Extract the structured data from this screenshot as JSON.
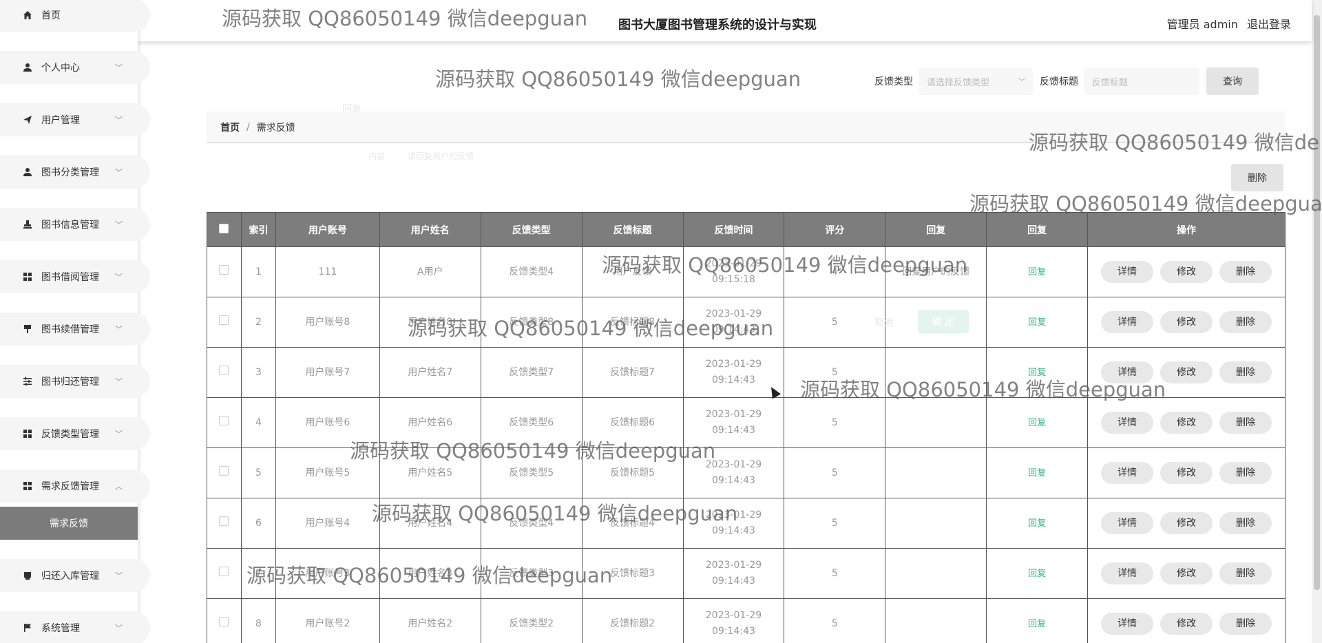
{
  "header": {
    "system_title": "图书大厦图书管理系统的设计与实现",
    "user_label": "管理员 admin",
    "logout_label": "退出登录"
  },
  "sidebar": {
    "items": [
      {
        "label": "首页",
        "icon": "home-icon"
      },
      {
        "label": "个人中心",
        "icon": "person-icon"
      },
      {
        "label": "用户管理",
        "icon": "paper-plane-icon"
      },
      {
        "label": "图书分类管理",
        "icon": "person-icon"
      },
      {
        "label": "图书信息管理",
        "icon": "stamp-icon"
      },
      {
        "label": "图书借阅管理",
        "icon": "grid-icon"
      },
      {
        "label": "图书续借管理",
        "icon": "brush-icon"
      },
      {
        "label": "图书归还管理",
        "icon": "sliders-icon"
      },
      {
        "label": "反馈类型管理",
        "icon": "grid-icon"
      },
      {
        "label": "需求反馈管理",
        "icon": "grid-icon"
      },
      {
        "label": "归还入库管理",
        "icon": "printer-icon"
      },
      {
        "label": "系统管理",
        "icon": "flag-icon"
      }
    ],
    "active_submenu": "需求反馈"
  },
  "search": {
    "type_label": "反馈类型",
    "type_placeholder": "请选择反馈类型",
    "title_label": "反馈标题",
    "title_placeholder": "反馈标题",
    "query_button": "查询"
  },
  "breadcrumb": {
    "home": "首页",
    "separator": "/",
    "current": "需求反馈"
  },
  "toolbar": {
    "delete_button": "删除"
  },
  "table": {
    "headers": [
      "索引",
      "用户账号",
      "用户姓名",
      "反馈类型",
      "反馈标题",
      "反馈时间",
      "评分",
      "回复",
      "回复",
      "操作"
    ],
    "reply_link": "回复",
    "actions": [
      "详情",
      "修改",
      "删除"
    ],
    "rows": [
      {
        "index": "1",
        "account": "111",
        "name": "A用户",
        "type": "反馈类型4",
        "title": "用户反馈",
        "time": "2023-01-29 09:15:18",
        "score": "4",
        "reply": "回复用户的反馈"
      },
      {
        "index": "2",
        "account": "用户账号8",
        "name": "用户姓名8",
        "type": "反馈类型8",
        "title": "反馈标题8",
        "time": "2023-01-29 09:14:43",
        "score": "5",
        "reply": ""
      },
      {
        "index": "3",
        "account": "用户账号7",
        "name": "用户姓名7",
        "type": "反馈类型7",
        "title": "反馈标题7",
        "time": "2023-01-29 09:14:43",
        "score": "5",
        "reply": ""
      },
      {
        "index": "4",
        "account": "用户账号6",
        "name": "用户姓名6",
        "type": "反馈类型6",
        "title": "反馈标题6",
        "time": "2023-01-29 09:14:43",
        "score": "5",
        "reply": ""
      },
      {
        "index": "5",
        "account": "用户账号5",
        "name": "用户姓名5",
        "type": "反馈类型5",
        "title": "反馈标题5",
        "time": "2023-01-29 09:14:43",
        "score": "5",
        "reply": ""
      },
      {
        "index": "6",
        "account": "用户账号4",
        "name": "用户姓名4",
        "type": "反馈类型4",
        "title": "反馈标题4",
        "time": "2023-01-29 09:14:43",
        "score": "5",
        "reply": ""
      },
      {
        "index": "7",
        "account": "用户账号3",
        "name": "用户姓名3",
        "type": "反馈类型3",
        "title": "反馈标题3",
        "time": "2023-01-29 09:14:43",
        "score": "5",
        "reply": ""
      },
      {
        "index": "8",
        "account": "用户账号2",
        "name": "用户姓名2",
        "type": "反馈类型2",
        "title": "反馈标题2",
        "time": "2023-01-29 09:14:43",
        "score": "5",
        "reply": ""
      }
    ]
  },
  "watermark": {
    "text": "源码获取 QQ86050149 微信deepguan",
    "text_clipped": "源码获取 QQ86050149 微信de",
    "text_clipped2": "源码获取 QQ86050149 微信deepgua"
  },
  "ghost": {
    "reply_title": "回复",
    "reply_content": "内容",
    "reply_placeholder": "请回复用户的反馈",
    "cancel": "取消",
    "confirm": "确 定"
  }
}
